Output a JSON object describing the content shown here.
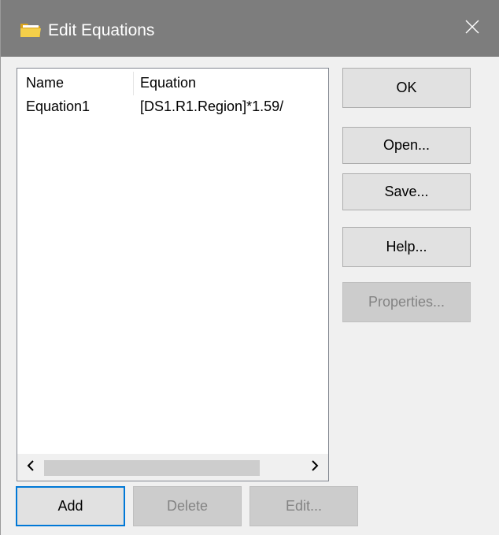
{
  "window": {
    "title": "Edit Equations",
    "close_glyph": "✕",
    "title_icon": "folder-icon"
  },
  "list": {
    "columns": [
      "Name",
      "Equation"
    ],
    "rows": [
      {
        "name": "Equation1",
        "equation": "[DS1.R1.Region]*1.59/"
      }
    ],
    "scroll_left": "<",
    "scroll_right": ">"
  },
  "buttons": {
    "ok": "OK",
    "open": "Open...",
    "save": "Save...",
    "help": "Help...",
    "properties": "Properties...",
    "add": "Add",
    "delete": "Delete",
    "edit": "Edit..."
  },
  "colors": {
    "titlebar": "#7d7d7d",
    "focus_border": "#0078d7",
    "disabled_text": "#838383"
  }
}
